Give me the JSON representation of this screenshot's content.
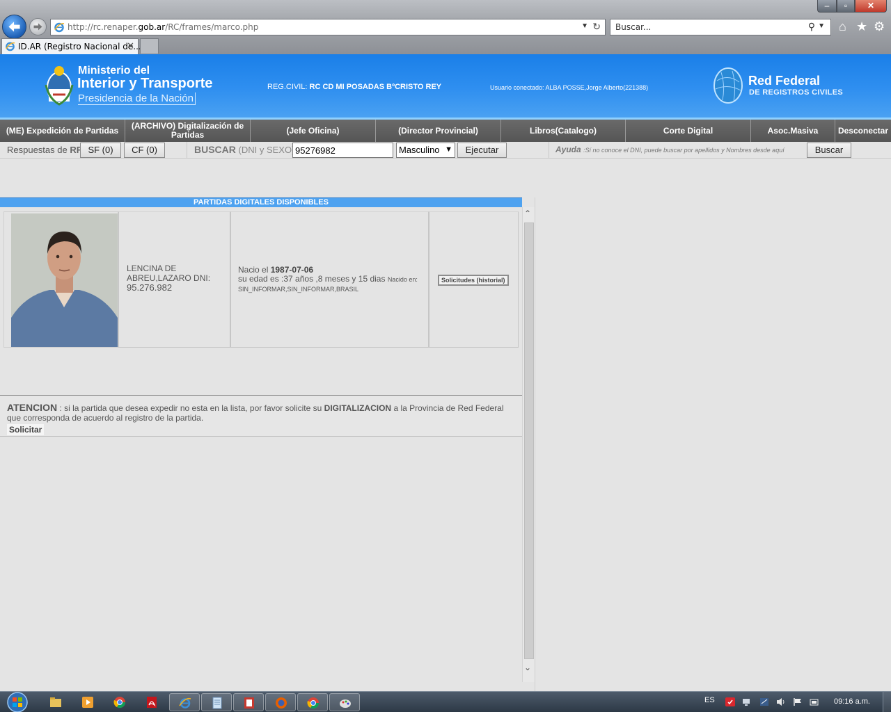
{
  "browser": {
    "url_prefix": "http://rc.renaper.",
    "url_domain": "gob.ar",
    "url_path": "/RC/frames/marco.php",
    "search_placeholder": "Buscar...",
    "tab_title": "ID.AR (Registro Nacional de...",
    "tab_close": "✕",
    "window_controls": {
      "minimize": "‒",
      "maximize": "▫",
      "close": "✕"
    }
  },
  "header": {
    "ministry_line1": "Ministerio del",
    "ministry_line2": "Interior y Transporte",
    "ministry_line3": "Presidencia de la Nación",
    "reg_civil_label": "REG.CIVIL:",
    "reg_civil_value": "RC CD MI POSADAS BºCRISTO REY",
    "user_connected": "Usuario conectado: ALBA POSSE,Jorge Alberto(221388)",
    "red_federal_title": "Red Federal",
    "red_federal_subtitle": "DE REGISTROS CIVILES",
    "colors": {
      "header_blue": "#1a7fe8",
      "menu_gray": "#5e5e5e"
    }
  },
  "menu": {
    "items": [
      {
        "label": "(ME) Expedición de Partidas"
      },
      {
        "label": "(ARCHIVO) Digitalización de Partidas"
      },
      {
        "label": "(Jefe Oficina)"
      },
      {
        "label": "(Director Provincial)"
      },
      {
        "label": "Libros(Catalogo)"
      },
      {
        "label": "Corte Digital"
      },
      {
        "label": "Asoc.Masiva"
      },
      {
        "label": "Desconectar"
      }
    ]
  },
  "toolbar": {
    "responses_label": "Respuestas de",
    "responses_rf": "RF",
    "sf_button": "SF (0)",
    "cf_button": "CF (0)",
    "buscar_label": "BUSCAR",
    "buscar_hint": "(DNI y SEXO)",
    "dni_value": "95276982",
    "sex_selected": "Masculino",
    "ejecutar_button": "Ejecutar",
    "ayuda_label": "Ayuda",
    "ayuda_text": ":Sí no conoce el DNI, puede buscar por apellidos y Nombres desde aquí",
    "buscar_button": "Buscar"
  },
  "results": {
    "title": "PARTIDAS DIGITALES DISPONIBLES",
    "person": {
      "name": "LENCINA DE ABREU,LAZARO DNI:",
      "dni": "95.276.982",
      "born_label": "Nacio el",
      "born_date": "1987-07-06",
      "age_text": "su edad es :37 años ,8 meses y 15 dias",
      "birthplace_label": "Nacido en:",
      "birthplace": "SIN_INFORMAR,SIN_INFORMAR,BRASIL",
      "history_button": "Solicitudes (historial)"
    }
  },
  "attention": {
    "title": "ATENCION",
    "text_1": ": si la partida que desea expedir no esta en la lista, por favor solicite su",
    "highlight": "DIGITALIZACION",
    "text_2": "a la Provincia de Red Federal que corresponda de acuerdo al registro de la partida.",
    "solicitar_button": "Solicitar"
  },
  "taskbar": {
    "language": "ES",
    "clock": "09:16 a.m.",
    "apps": [
      "windows-explorer",
      "media-player",
      "chrome",
      "acrobat",
      "internet-explorer",
      "notepad",
      "office-app",
      "firefox",
      "chrome-window",
      "paint"
    ]
  }
}
